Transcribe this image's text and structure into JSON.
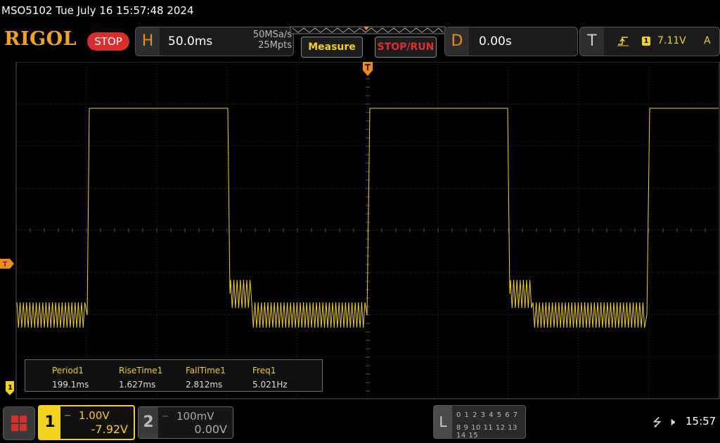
{
  "header": {
    "datetime": "MSO5102  Tue July 16 15:57:48 2024",
    "logo": "RIGOL",
    "run_state": "STOP"
  },
  "horizontal": {
    "letter": "H",
    "timebase": "50.0ms",
    "sample_rate": "50MSa/s",
    "memory_depth": "25Mpts"
  },
  "buttons": {
    "measure": "Measure",
    "stop_run": "STOP/RUN"
  },
  "delay": {
    "letter": "D",
    "value": "0.00s"
  },
  "trigger": {
    "letter": "T",
    "source": "1",
    "level": "7.11V",
    "coupling": "A",
    "marker_label": "T"
  },
  "measurements": [
    {
      "label": "Period1",
      "value": "199.1ms"
    },
    {
      "label": "RiseTime1",
      "value": "1.627ms"
    },
    {
      "label": "FallTime1",
      "value": "2.812ms"
    },
    {
      "label": "Freq1",
      "value": "5.021Hz"
    }
  ],
  "channels": {
    "ch1": {
      "number": "1",
      "scale": "1.00V",
      "offset": "-7.92V",
      "color": "#f2d21a",
      "marker_label": "1"
    },
    "ch2": {
      "number": "2",
      "scale": "100mV",
      "offset": "0.00V",
      "color": "#aaaaaa"
    }
  },
  "logic_analyzer": {
    "letter": "L",
    "row1": "0 1 2 3  4 5 6 7",
    "row2": "8 9 10 11 12 13 14 15"
  },
  "status": {
    "clock": "15:57"
  },
  "waveform": {
    "color": "#f2d21a",
    "period_ms": 199.1,
    "grid_divisions": {
      "horizontal": 10,
      "vertical": 8
    }
  }
}
